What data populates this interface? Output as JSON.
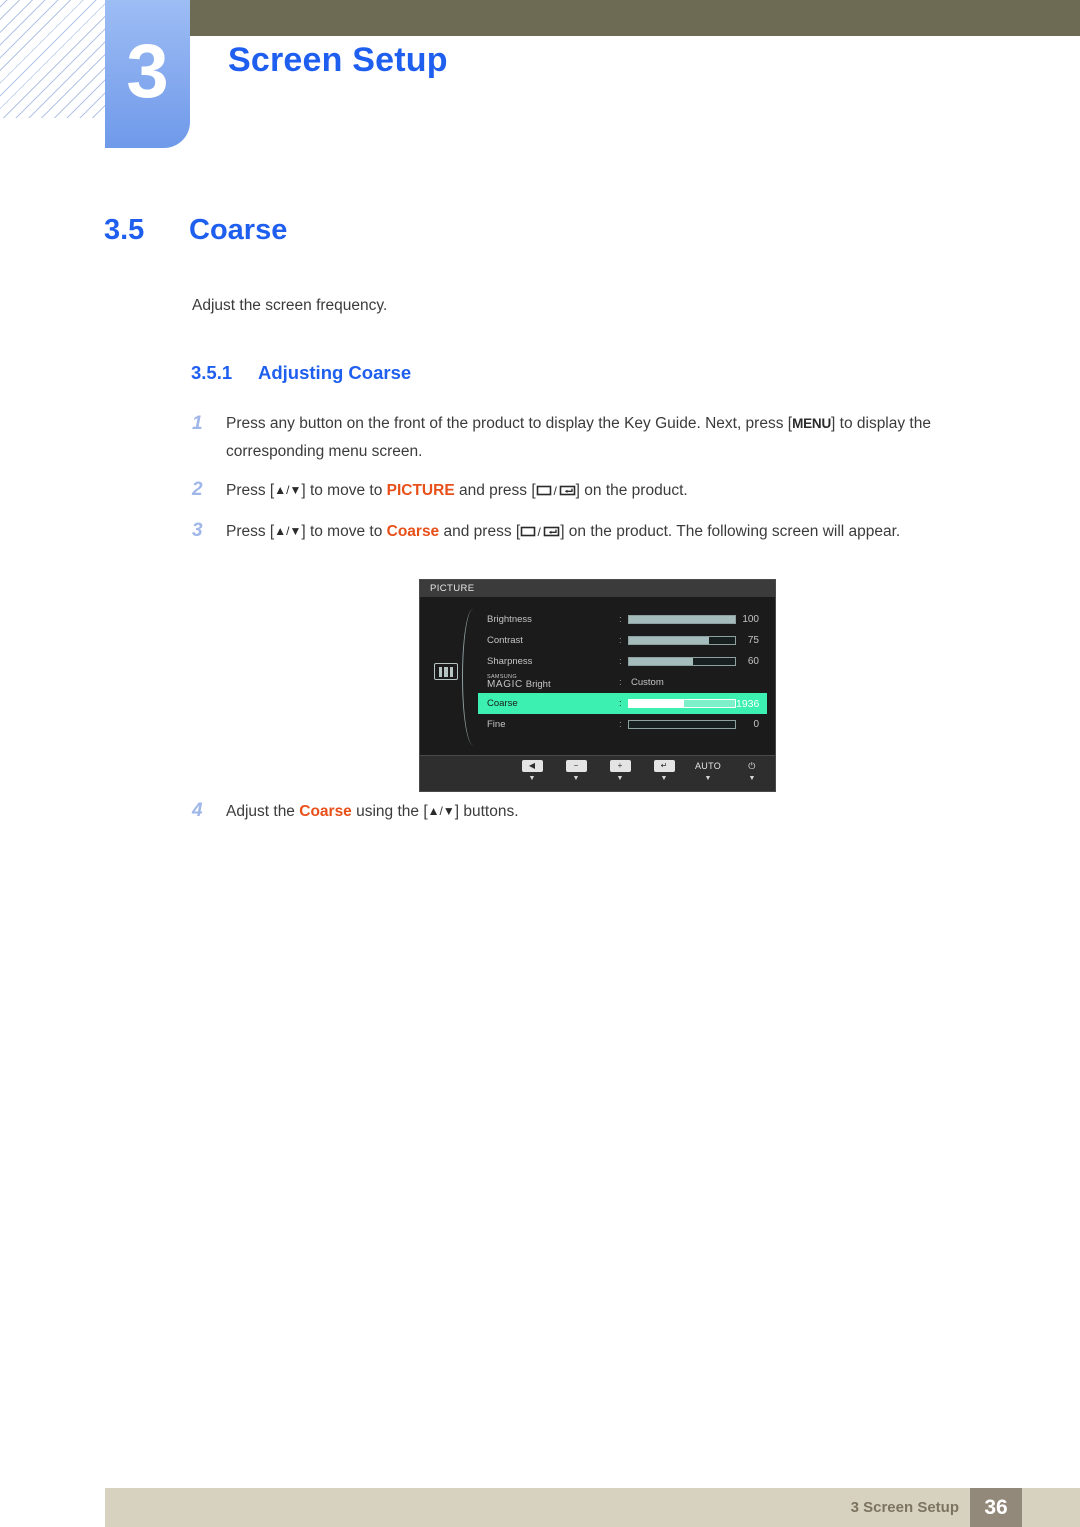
{
  "header": {
    "chapter_number": "3",
    "chapter_title": "Screen Setup"
  },
  "section": {
    "number": "3.5",
    "title": "Coarse",
    "intro": "Adjust the screen frequency.",
    "sub_number": "3.5.1",
    "sub_title": "Adjusting Coarse"
  },
  "steps": [
    {
      "index": "1",
      "text_a": "Press any button on the front of the product to display the Key Guide. Next, press [",
      "menu_label": "MENU",
      "text_b": "] to display the corresponding menu screen."
    },
    {
      "index": "2",
      "text_a": "Press [",
      "updown": "▲/▼",
      "text_b": "] to move to ",
      "keyword": "PICTURE",
      "text_c": " and press [",
      "text_d": "] on the product."
    },
    {
      "index": "3",
      "text_a": "Press [",
      "updown": "▲/▼",
      "text_b": "] to move to ",
      "keyword": "Coarse",
      "text_c": " and press [",
      "text_d": "] on the product. The following screen will appear."
    },
    {
      "index": "4",
      "text_a": "Adjust the ",
      "keyword": "Coarse",
      "text_b": " using the [",
      "updown": "▲/▼",
      "text_c": "] buttons."
    }
  ],
  "osd": {
    "title": "PICTURE",
    "side_icon": "picture-bars-icon",
    "rows": [
      {
        "label": "Brightness",
        "colon": ":",
        "value": "100",
        "fill_pct": 100,
        "kind": "bar",
        "selected": false
      },
      {
        "label": "Contrast",
        "colon": ":",
        "value": "75",
        "fill_pct": 75,
        "kind": "bar",
        "selected": false
      },
      {
        "label": "Sharpness",
        "colon": ":",
        "value": "60",
        "fill_pct": 60,
        "kind": "bar",
        "selected": false
      },
      {
        "label_small": "SAMSUNG",
        "label_main": "MAGIC",
        "label_suffix": "Bright",
        "colon": ":",
        "value": "Custom",
        "kind": "text",
        "selected": false
      },
      {
        "label": "Coarse",
        "colon": ":",
        "value": "1936",
        "fill_pct": 52,
        "kind": "bar",
        "selected": true
      },
      {
        "label": "Fine",
        "colon": ":",
        "value": "0",
        "fill_pct": 0,
        "kind": "bar",
        "selected": false
      }
    ],
    "footer_buttons": [
      {
        "name": "back-button",
        "glyph": "◀",
        "marker": "▼"
      },
      {
        "name": "minus-button",
        "glyph": "−",
        "marker": "▼"
      },
      {
        "name": "plus-button",
        "glyph": "+",
        "marker": "▼"
      },
      {
        "name": "enter-button",
        "glyph": "↵",
        "marker": "▼"
      },
      {
        "name": "auto-button",
        "glyph": "AUTO",
        "marker": "▼"
      },
      {
        "name": "power-button",
        "glyph": "⏻",
        "marker": "▼"
      }
    ]
  },
  "footer": {
    "text": "3 Screen Setup",
    "page": "36"
  },
  "colors": {
    "accent_blue": "#1f5ff0",
    "keyword_orange": "#e8501a",
    "osd_highlight": "#3bf0b0",
    "olive_bar": "#6e6b55",
    "footer_bg": "#d6d2bf",
    "page_box": "#92897a"
  }
}
